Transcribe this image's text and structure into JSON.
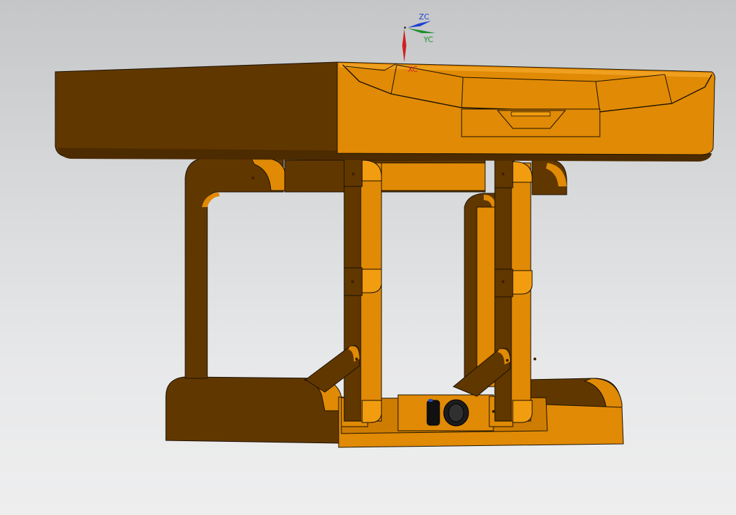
{
  "viewport": {
    "background_top": "#c4c6c8",
    "background_bottom": "#eeeeef"
  },
  "triad": {
    "z_label": "ZC",
    "y_label": "YC",
    "x_label": "XC",
    "z_color": "#2040d0",
    "y_color": "#1f8f2f",
    "x_color": "#d02020"
  },
  "model": {
    "light_color": "#e08a05",
    "dark_color": "#613700",
    "edge_color": "#1a1000"
  }
}
